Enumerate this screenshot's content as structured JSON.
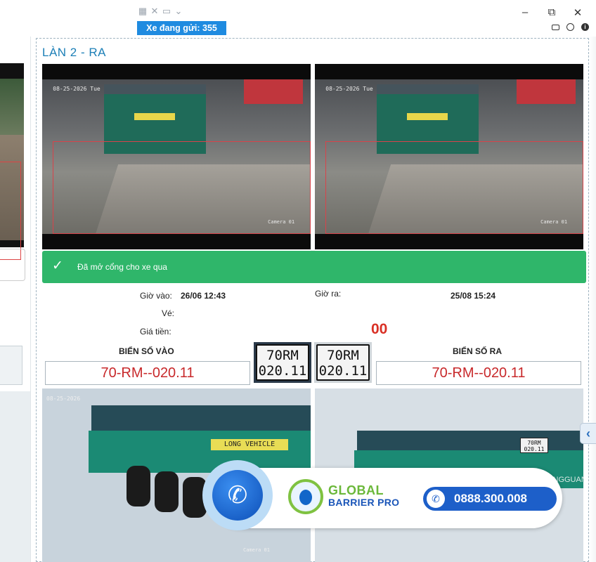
{
  "window": {
    "counter_label": "Xe đang gửi: 355",
    "toolbar_icons": [
      "grid-icon",
      "resize-icon",
      "monitor-icon",
      "chevron-down-icon"
    ],
    "controls": {
      "minimize": "–",
      "restore": "⧉",
      "close": "✕"
    },
    "status_icons": [
      "keyboard-icon",
      "globe-icon",
      "info-icon"
    ],
    "info_glyph": "i"
  },
  "lane": {
    "title": "LÀN 2 - RA",
    "cam_in": {
      "timestamp": "08-25-2026 Tue",
      "camera": "Camera 01"
    },
    "cam_out": {
      "timestamp": "08-25-2026 Tue",
      "camera": "Camera 01"
    },
    "notification": {
      "icon": "check-icon",
      "glyph": "✓",
      "message": "Đã mở cổng cho xe qua",
      "color": "#2fb66a"
    },
    "details": {
      "time_in_label": "Giờ vào:",
      "time_in": "26/06 12:43",
      "time_out_label": "Giờ ra:",
      "time_out": "25/08 15:24",
      "ticket_label": "Vé:",
      "ticket": "",
      "price_label": "Giá tiền:",
      "price": "00"
    },
    "plates": {
      "in_label": "BIỂN SỐ VÀO",
      "in_value": "70-RM--020.11",
      "out_label": "BIỂN SỐ RA",
      "out_value": "70-RM--020.11",
      "crop_in": {
        "line1": "70RM",
        "line2": "020.11"
      },
      "crop_out": {
        "line1": "70RM",
        "line2": "020.11"
      }
    },
    "photos": {
      "in": {
        "timestamp": "08-25-2026",
        "sign": "LONG VEHICLE",
        "camera": "Camera 01"
      },
      "out": {
        "plate_line1": "70RM",
        "plate_line2": "020.11",
        "brand": "DONGGUAN"
      }
    }
  },
  "banner": {
    "brand_line1": "GLOBAL",
    "brand_line2": "BARRIER PRO",
    "hotline": "0888.300.008",
    "phone_glyph": "✆"
  },
  "colors": {
    "accent": "#1f8be0",
    "success": "#2fb66a",
    "price": "#d93025",
    "plate_text": "#c8292b"
  }
}
